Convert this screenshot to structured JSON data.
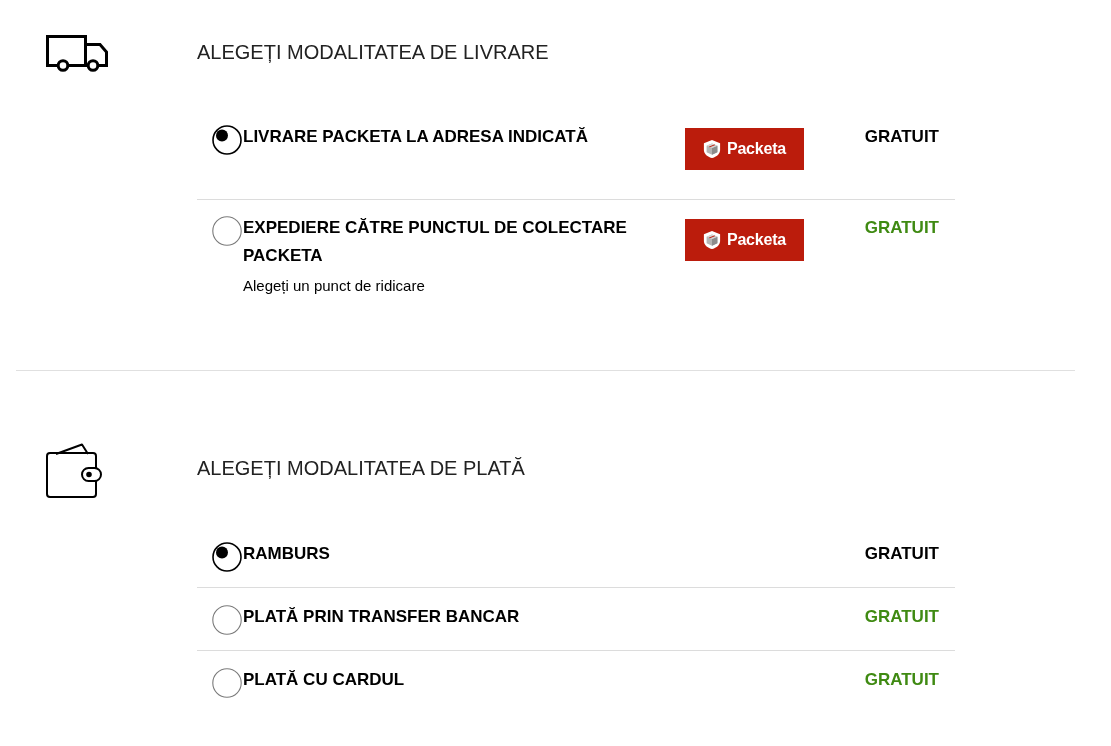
{
  "sections": [
    {
      "kind": "delivery",
      "title": "ALEGEȚI MODALITATEA DE LIVRARE",
      "options": [
        {
          "label": "LIVRARE PACKETA LA ADRESA INDICATĂ",
          "logo": "Packeta",
          "price": "GRATUIT",
          "selected": true
        },
        {
          "label": "EXPEDIERE CĂTRE PUNCTUL DE COLECTARE PACKETA",
          "note": "Alegeți un punct de ridicare",
          "logo": "Packeta",
          "price": "GRATUIT",
          "selected": false
        }
      ]
    },
    {
      "kind": "payment",
      "title": "ALEGEȚI MODALITATEA DE PLATĂ",
      "options": [
        {
          "label": "RAMBURS",
          "price": "GRATUIT",
          "selected": true
        },
        {
          "label": "PLATĂ PRIN TRANSFER BANCAR",
          "price": "GRATUIT",
          "selected": false
        },
        {
          "label": "PLATĂ CU CARDUL",
          "price": "GRATUIT",
          "selected": false
        }
      ]
    }
  ]
}
